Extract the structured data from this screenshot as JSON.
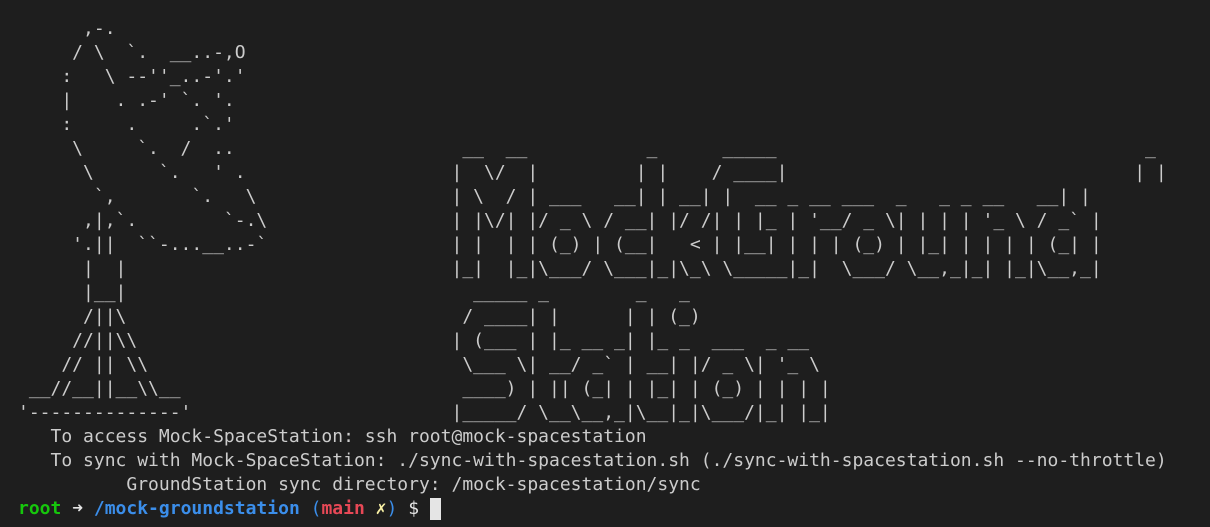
{
  "terminal": {
    "banner": "      ,-.\n     / \\  `.  __..-,O\n    :   \\ --''_..-'.'\n    |    . .-' `. '.\n    :     .     .`.'\n     \\     `.  /  ..                     __  __           _      _____                                  _\n      \\      `.   ' .                   |  \\/  |         | |    / ____|                                | |\n       `,       `.   \\                  | \\  / | ___   __| | __| |  __ _ __ ___  _   _ _ __   __| |\n      ,|,`.        `-.\\                 | |\\/| |/ _ \\ / __| |/ /| | |_ | '__/ _ \\| | | | '_ \\ / _` |\n     '.||  ``-...__..-`                 | |  | | (_) | (__|   < | |__| | | | (_) | |_| | | | | (_| |\n      |  |                              |_|  |_|\\___/ \\___|_|\\_\\ \\_____|_|  \\___/ \\__,_|_| |_|\\__,_|\n      |__|                                _____ _        _   _\n      /||\\                               / ____| |      | | (_)\n     //||\\\\                             | (___ | |_ __ _| |_ _  ___  _ __\n    // || \\\\                             \\___ \\| __/ _` | __| |/ _ \\| '_ \\\n __//__||__\\\\__                          ____) | || (_| | |_| | (_) | | | |\n'--------------'                        |_____/ \\__\\__,_|\\__|_|\\___/|_| |_|",
    "info_line_1": "   To access Mock-SpaceStation: ssh root@mock-spacestation",
    "info_line_2": "   To sync with Mock-SpaceStation: ./sync-with-spacestation.sh (./sync-with-spacestation.sh --no-throttle)",
    "info_line_3": "          GroundStation sync directory: /mock-spacestation/sync",
    "prompt": {
      "user": "root",
      "arrow": " ➜ ",
      "directory": "/mock-groundstation",
      "paren_open": " (",
      "branch": "main",
      "dirty_mark": " ✗",
      "paren_close": ")",
      "dollar": " $ "
    }
  }
}
